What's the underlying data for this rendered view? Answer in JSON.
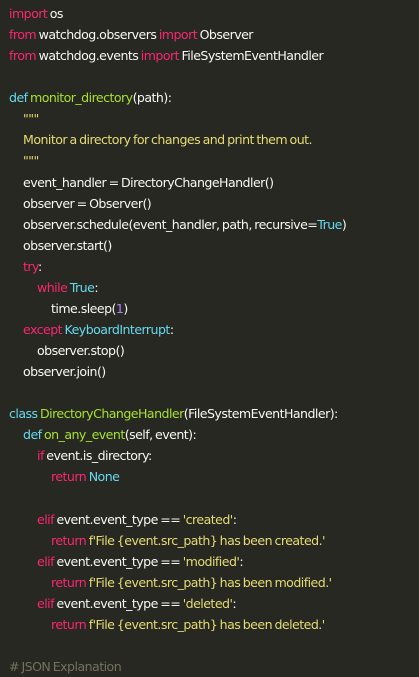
{
  "colors": {
    "background": "#272822",
    "text": "#f8f8f2",
    "keyword": "#f92672",
    "builtin": "#66d9ef",
    "function": "#a6e22e",
    "string": "#e6db74",
    "number": "#ae81ff",
    "comment": "#75715e"
  },
  "lines": [
    [
      {
        "t": "import",
        "c": "kw"
      },
      {
        "t": " os",
        "c": "plain"
      }
    ],
    [
      {
        "t": "from",
        "c": "kw"
      },
      {
        "t": " watchdog.observers ",
        "c": "plain"
      },
      {
        "t": "import",
        "c": "kw"
      },
      {
        "t": " Observer",
        "c": "plain"
      }
    ],
    [
      {
        "t": "from",
        "c": "kw"
      },
      {
        "t": " watchdog.events ",
        "c": "plain"
      },
      {
        "t": "import",
        "c": "kw"
      },
      {
        "t": " FileSystemEventHandler",
        "c": "plain"
      }
    ],
    [],
    [
      {
        "t": "def",
        "c": "kw2"
      },
      {
        "t": " ",
        "c": "plain"
      },
      {
        "t": "monitor_directory",
        "c": "fn"
      },
      {
        "t": "(path):",
        "c": "plain"
      }
    ],
    [
      {
        "t": "\"\"\"",
        "c": "str",
        "i": 1
      }
    ],
    [
      {
        "t": "Monitor a directory for changes and print them out.",
        "c": "str",
        "i": 1
      }
    ],
    [
      {
        "t": "\"\"\"",
        "c": "str",
        "i": 1
      }
    ],
    [
      {
        "t": "event_handler = DirectoryChangeHandler()",
        "c": "plain",
        "i": 1
      }
    ],
    [
      {
        "t": "observer = Observer()",
        "c": "plain",
        "i": 1
      }
    ],
    [
      {
        "t": "observer.schedule(event_handler, path, recursive=",
        "c": "plain",
        "i": 1
      },
      {
        "t": "True",
        "c": "kw2"
      },
      {
        "t": ")",
        "c": "plain"
      }
    ],
    [
      {
        "t": "observer.start()",
        "c": "plain",
        "i": 1
      }
    ],
    [
      {
        "t": "try",
        "c": "kw",
        "i": 1
      },
      {
        "t": ":",
        "c": "plain"
      }
    ],
    [
      {
        "t": "while",
        "c": "kw",
        "i": 2
      },
      {
        "t": " ",
        "c": "plain"
      },
      {
        "t": "True",
        "c": "kw2"
      },
      {
        "t": ":",
        "c": "plain"
      }
    ],
    [
      {
        "t": "time.sleep(",
        "c": "plain",
        "i": 3
      },
      {
        "t": "1",
        "c": "num"
      },
      {
        "t": ")",
        "c": "plain"
      }
    ],
    [
      {
        "t": "except",
        "c": "kw",
        "i": 1
      },
      {
        "t": " ",
        "c": "plain"
      },
      {
        "t": "KeyboardInterrupt",
        "c": "kw2"
      },
      {
        "t": ":",
        "c": "plain"
      }
    ],
    [
      {
        "t": "observer.stop()",
        "c": "plain",
        "i": 2
      }
    ],
    [
      {
        "t": "observer.join()",
        "c": "plain",
        "i": 1
      }
    ],
    [],
    [
      {
        "t": "class",
        "c": "kw2"
      },
      {
        "t": " ",
        "c": "plain"
      },
      {
        "t": "DirectoryChangeHandler",
        "c": "fn"
      },
      {
        "t": "(FileSystemEventHandler):",
        "c": "plain"
      }
    ],
    [
      {
        "t": "def",
        "c": "kw2",
        "i": 1
      },
      {
        "t": " ",
        "c": "plain"
      },
      {
        "t": "on_any_event",
        "c": "fn"
      },
      {
        "t": "(self, event):",
        "c": "plain"
      }
    ],
    [
      {
        "t": "if",
        "c": "kw",
        "i": 2
      },
      {
        "t": " event.is_directory:",
        "c": "plain"
      }
    ],
    [
      {
        "t": "return",
        "c": "kw",
        "i": 3
      },
      {
        "t": " ",
        "c": "plain"
      },
      {
        "t": "None",
        "c": "kw2"
      }
    ],
    [],
    [
      {
        "t": "elif",
        "c": "kw",
        "i": 2
      },
      {
        "t": " event.event_type == ",
        "c": "plain"
      },
      {
        "t": "'created'",
        "c": "str"
      },
      {
        "t": ":",
        "c": "plain"
      }
    ],
    [
      {
        "t": "return",
        "c": "kw",
        "i": 3
      },
      {
        "t": " ",
        "c": "plain"
      },
      {
        "t": "f'File {event.src_path} has been created.'",
        "c": "str"
      }
    ],
    [
      {
        "t": "elif",
        "c": "kw",
        "i": 2
      },
      {
        "t": " event.event_type == ",
        "c": "plain"
      },
      {
        "t": "'modified'",
        "c": "str"
      },
      {
        "t": ":",
        "c": "plain"
      }
    ],
    [
      {
        "t": "return",
        "c": "kw",
        "i": 3
      },
      {
        "t": " ",
        "c": "plain"
      },
      {
        "t": "f'File {event.src_path} has been modified.'",
        "c": "str"
      }
    ],
    [
      {
        "t": "elif",
        "c": "kw",
        "i": 2
      },
      {
        "t": " event.event_type == ",
        "c": "plain"
      },
      {
        "t": "'deleted'",
        "c": "str"
      },
      {
        "t": ":",
        "c": "plain"
      }
    ],
    [
      {
        "t": "return",
        "c": "kw",
        "i": 3
      },
      {
        "t": " ",
        "c": "plain"
      },
      {
        "t": "f'File {event.src_path} has been deleted.'",
        "c": "str"
      }
    ],
    [],
    [
      {
        "t": "# JSON Explanation",
        "c": "com"
      }
    ]
  ]
}
